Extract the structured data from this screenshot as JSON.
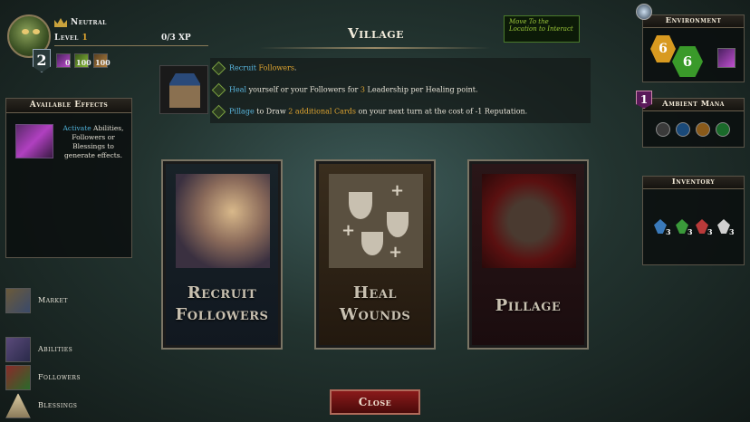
{
  "player": {
    "alignment": "Neutral",
    "level_label": "Level",
    "level_value": "1",
    "xp": "0/3 XP",
    "leadership": "2",
    "resources": [
      "0",
      "100",
      "100"
    ]
  },
  "effects_panel": {
    "title": "Available Effects",
    "text_highlight": "Activate",
    "text_rest": " Abilities, Followers or Blessings to generate effects."
  },
  "nav": {
    "market": "Market",
    "abilities": "Abilities",
    "followers": "Followers",
    "blessings": "Blessings"
  },
  "location": {
    "title": "Village",
    "hint": "Move To the Location to Interact"
  },
  "instructions": [
    {
      "pre": "",
      "hl1": "Recruit",
      "mid": " ",
      "hl2": "Followers",
      "post": "."
    },
    {
      "pre": "",
      "hl1": "Heal",
      "mid": " yourself or your Followers for ",
      "hl2": "3",
      "post": " Leadership per Healing point."
    },
    {
      "pre": "",
      "hl1": "Pillage",
      "mid": " to Draw ",
      "hl2": "2 additional Cards",
      "post": " on your next turn at the cost of -1 Reputation."
    }
  ],
  "cards": {
    "recruit": "Recruit Followers",
    "heal": "Heal Wounds",
    "pillage": "Pillage"
  },
  "close_label": "Close",
  "environment": {
    "title": "Environment",
    "hex_gold": "6",
    "hex_green": "6"
  },
  "ambient_mana": {
    "title": "Ambient Mana",
    "count": "1"
  },
  "inventory": {
    "title": "Inventory",
    "items": [
      "3",
      "3",
      "3",
      "3"
    ]
  },
  "colors": {
    "highlight_blue": "#5ab8e0",
    "highlight_gold": "#e0a530",
    "hint_green": "#9cc83a",
    "close_red": "#8a1a1a"
  }
}
